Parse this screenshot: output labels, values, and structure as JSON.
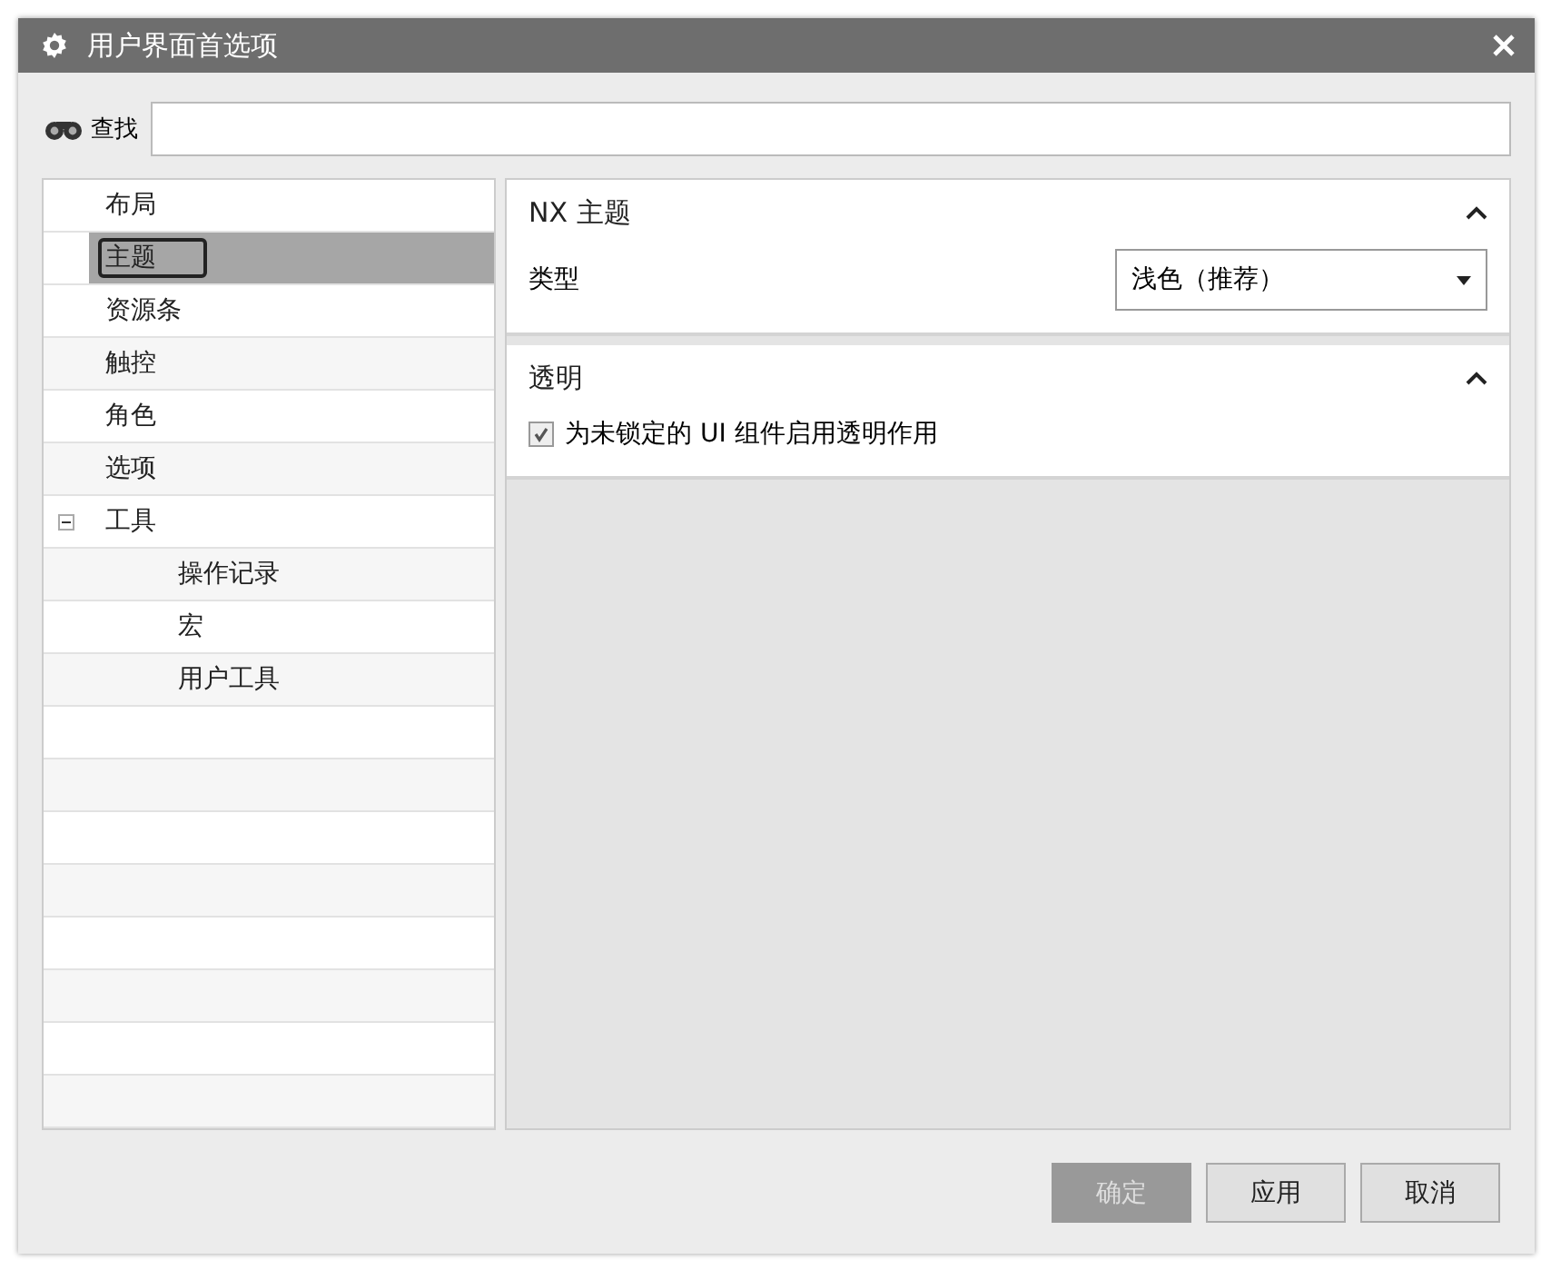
{
  "window": {
    "title": "用户界面首选项"
  },
  "search": {
    "label": "查找"
  },
  "tree": [
    {
      "label": "布局",
      "selected": false
    },
    {
      "label": "主题",
      "selected": true
    },
    {
      "label": "资源条",
      "selected": false
    },
    {
      "label": "触控",
      "selected": false
    },
    {
      "label": "角色",
      "selected": false
    },
    {
      "label": "选项",
      "selected": false
    },
    {
      "label": "工具",
      "selected": false,
      "expanded": true,
      "children": [
        {
          "label": "操作记录",
          "selected": false
        },
        {
          "label": "宏",
          "selected": false
        },
        {
          "label": "用户工具",
          "selected": false
        }
      ]
    }
  ],
  "sections": [
    {
      "title": "NX 主题",
      "expanded": true,
      "fields": [
        {
          "kind": "dropdown",
          "label": "类型",
          "value": "浅色（推荐）"
        }
      ]
    },
    {
      "title": "透明",
      "expanded": true,
      "fields": [
        {
          "kind": "checkbox",
          "label": "为未锁定的 UI 组件启用透明作用",
          "checked": true
        }
      ]
    }
  ],
  "buttons": [
    {
      "label": "确定",
      "kind": "default"
    },
    {
      "label": "应用",
      "kind": "normal"
    },
    {
      "label": "取消",
      "kind": "normal"
    }
  ]
}
